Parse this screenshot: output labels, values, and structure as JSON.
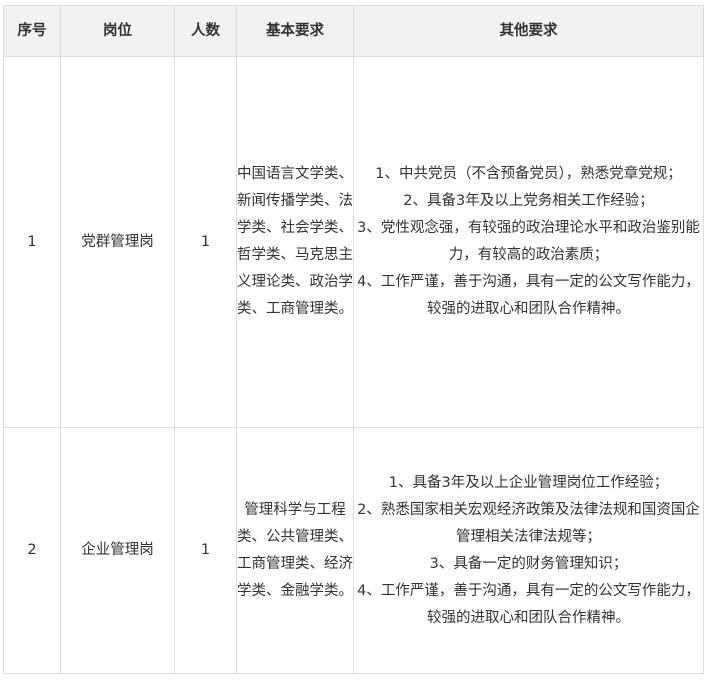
{
  "table": {
    "headers": {
      "seq": "序号",
      "position": "岗位",
      "count": "人数",
      "basic": "基本要求",
      "other": "其他要求"
    },
    "rows": [
      {
        "seq": "1",
        "position": "党群管理岗",
        "count": "1",
        "basic": "中国语言文学类、新闻传播学类、法学类、社会学类、哲学类、马克思主义理论类、政治学类、工商管理类。",
        "other": [
          "1、中共党员（不含预备党员），熟悉党章党规；",
          "2、具备3年及以上党务相关工作经验；",
          "3、党性观念强，有较强的政治理论水平和政治鉴别能力，有较高的政治素质；",
          "4、工作严谨，善于沟通，具有一定的公文写作能力，较强的进取心和团队合作精神。"
        ]
      },
      {
        "seq": "2",
        "position": "企业管理岗",
        "count": "1",
        "basic": "管理科学与工程类、公共管理类、工商管理类、经济学类、金融学类。",
        "other": [
          "1、具备3年及以上企业管理岗位工作经验；",
          "2、熟悉国家相关宏观经济政策及法律法规和国资国企管理相关法律法规等；",
          "3、具备一定的财务管理知识；",
          "4、工作严谨，善于沟通，具有一定的公文写作能力，较强的进取心和团队合作精神。"
        ]
      }
    ]
  }
}
